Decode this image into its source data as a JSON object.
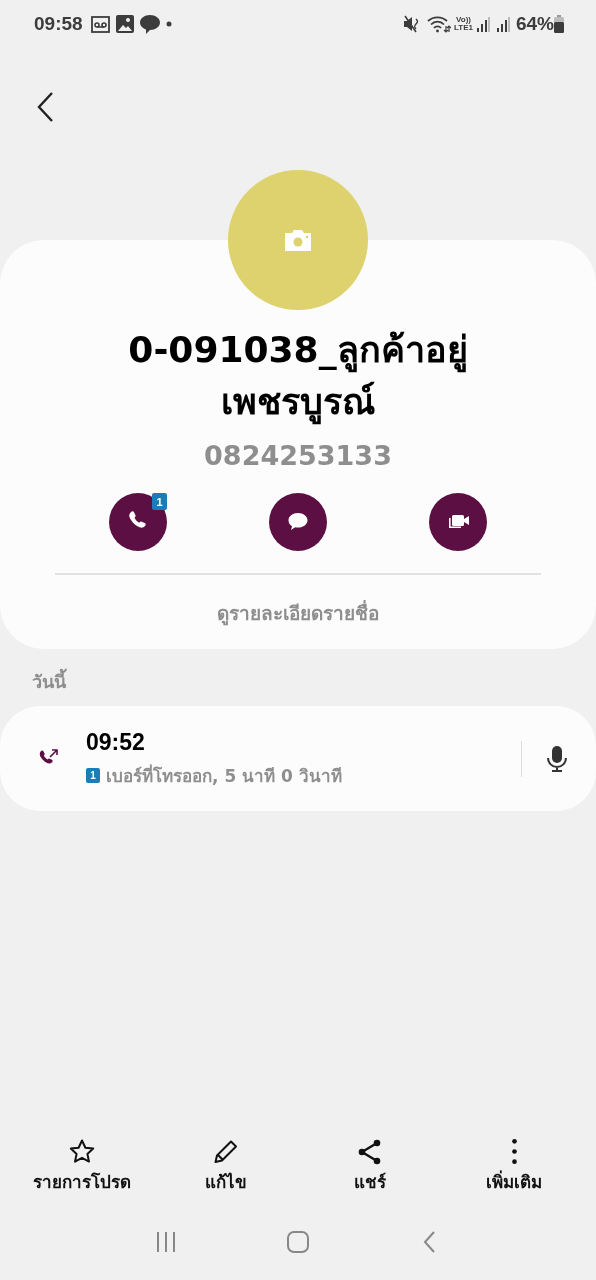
{
  "status_bar": {
    "time": "09:58",
    "network_top": "Vo))",
    "network_bottom": "LTE1",
    "battery": "64%"
  },
  "contact": {
    "name": "0-091038_ลูกค้าอยู่เพชรบูรณ์",
    "number": "0824253133",
    "details_link": "ดูรายละเอียดรายชื่อ"
  },
  "actions": [
    {
      "kind": "call",
      "badge": "1"
    },
    {
      "kind": "message"
    },
    {
      "kind": "video"
    }
  ],
  "history": {
    "heading": "วันนี้",
    "entries": [
      {
        "time": "09:52",
        "sim": "1",
        "description": "เบอร์ที่โทรออก, 5 นาที 0 วินาที"
      }
    ]
  },
  "bottom_bar": [
    {
      "kind": "favourite",
      "label": "รายการโปรด"
    },
    {
      "kind": "edit",
      "label": "แก้ไข"
    },
    {
      "kind": "share",
      "label": "แชร์"
    },
    {
      "kind": "more",
      "label": "เพิ่มเติม"
    }
  ]
}
